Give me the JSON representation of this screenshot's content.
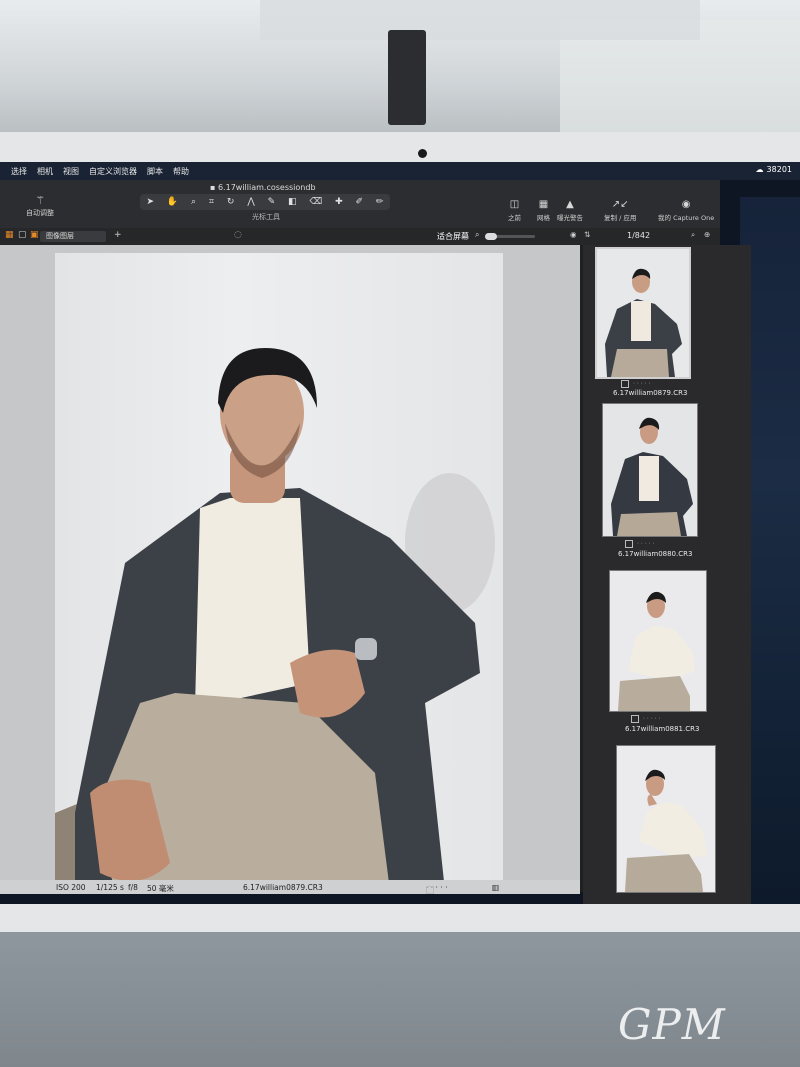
{
  "menubar": {
    "items": [
      "选择",
      "相机",
      "视图",
      "自定义浏览器",
      "脚本",
      "帮助"
    ],
    "status_value": "38201"
  },
  "titlebar": {
    "document_title": "6.17william.cosessiondb",
    "auto_adjust_label": "自动调整",
    "cursor_tools_label": "光标工具",
    "before_label": "之前",
    "grid_label": "网格",
    "exposure_warning_label": "曝光警告",
    "copy_apply_label": "复制 / 应用",
    "my_capture_one_label": "我的 Capture One"
  },
  "subbar": {
    "layer_select_value": "图像图层",
    "fit_label": "适合屏幕",
    "counter": "1/842"
  },
  "status": {
    "iso": "ISO 200",
    "shutter": "1/125 s",
    "aperture": "f/8",
    "focal": "50 毫米",
    "filename": "6.17william0879.CR3"
  },
  "thumbnails": [
    {
      "filename": "6.17william0879.CR3",
      "selected": true
    },
    {
      "filename": "6.17william0880.CR3",
      "selected": false
    },
    {
      "filename": "6.17william0881.CR3",
      "selected": false
    },
    {
      "filename": "",
      "selected": false
    }
  ],
  "watermark": "GPM",
  "colors": {
    "accent": "#e58a2a",
    "app_bg": "#1f2022",
    "viewer_bg": "#c5c7c8"
  }
}
